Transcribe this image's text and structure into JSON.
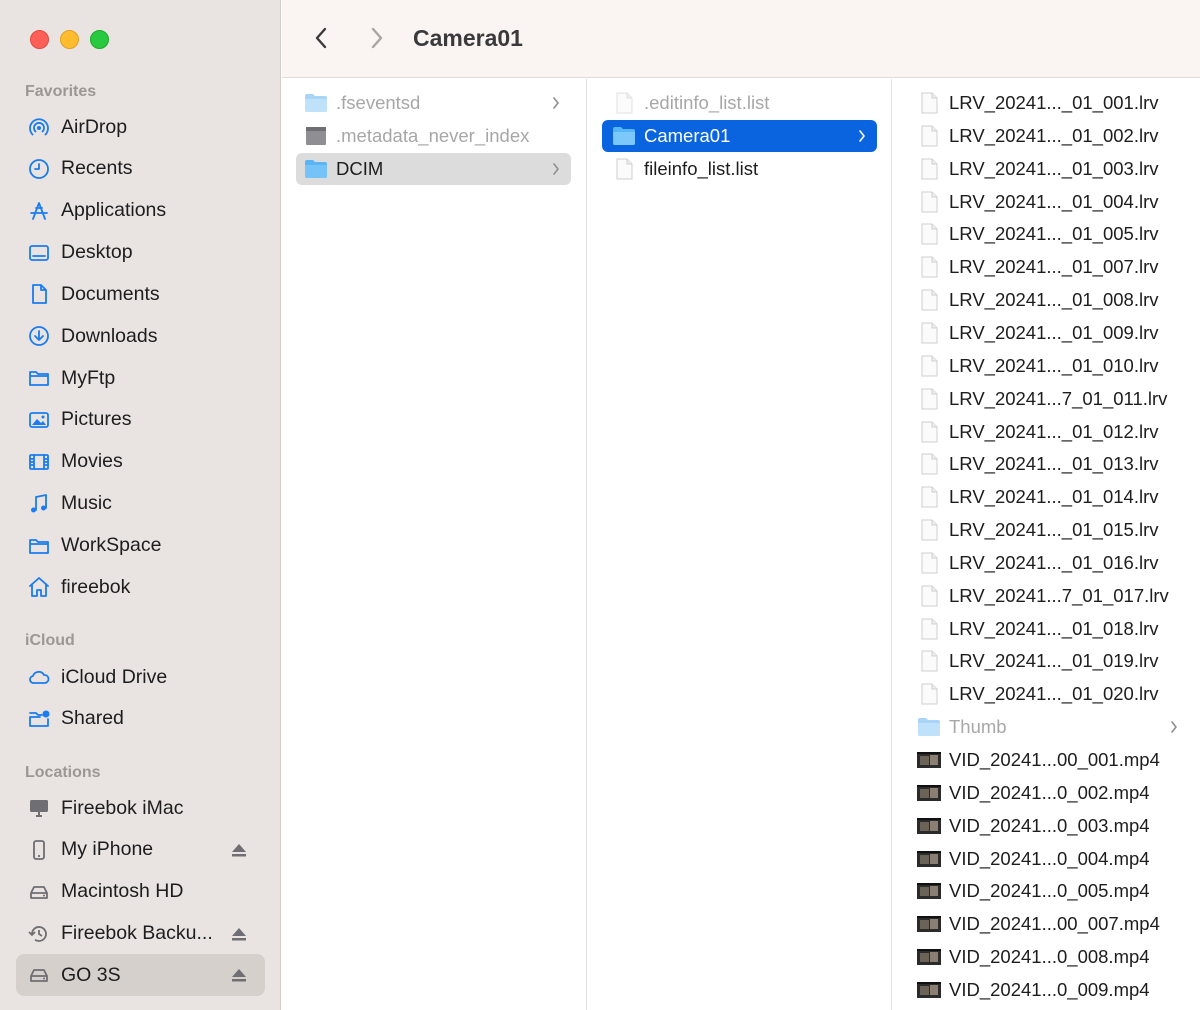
{
  "toolbar": {
    "title": "Camera01"
  },
  "sidebar": {
    "favorites_title": "Favorites",
    "favorites": [
      {
        "label": "AirDrop",
        "icon": "airdrop-icon"
      },
      {
        "label": "Recents",
        "icon": "clock-icon"
      },
      {
        "label": "Applications",
        "icon": "applications-icon"
      },
      {
        "label": "Desktop",
        "icon": "desktop-icon"
      },
      {
        "label": "Documents",
        "icon": "document-icon"
      },
      {
        "label": "Downloads",
        "icon": "download-icon"
      },
      {
        "label": "MyFtp",
        "icon": "folder-icon"
      },
      {
        "label": "Pictures",
        "icon": "pictures-icon"
      },
      {
        "label": "Movies",
        "icon": "film-icon"
      },
      {
        "label": "Music",
        "icon": "music-note-icon"
      },
      {
        "label": "WorkSpace",
        "icon": "folder-icon"
      },
      {
        "label": "fireebok",
        "icon": "home-icon"
      }
    ],
    "icloud_title": "iCloud",
    "icloud": [
      {
        "label": "iCloud Drive",
        "icon": "cloud-icon"
      },
      {
        "label": "Shared",
        "icon": "shared-folder-icon"
      }
    ],
    "locations_title": "Locations",
    "locations": [
      {
        "label": "Fireebok iMac",
        "icon": "imac-icon"
      },
      {
        "label": "My iPhone",
        "icon": "iphone-icon"
      },
      {
        "label": "Macintosh HD",
        "icon": "disk-icon"
      },
      {
        "label": "Fireebok Backu...",
        "icon": "time-machine-icon"
      },
      {
        "label": "GO 3S",
        "icon": "disk-icon"
      }
    ]
  },
  "column1": [
    {
      "name": ".fseventsd",
      "icon": "folder-icon",
      "dim": true
    },
    {
      "name": ".metadata_never_index",
      "icon": "gray-file-icon",
      "dim": true
    },
    {
      "name": "DCIM",
      "icon": "folder-icon",
      "selected": "gray"
    }
  ],
  "column2": [
    {
      "name": ".editinfo_list.list",
      "icon": "file-icon",
      "dim": true
    },
    {
      "name": "Camera01",
      "icon": "folder-icon",
      "selected": "blue"
    },
    {
      "name": "fileinfo_list.list",
      "icon": "file-icon"
    }
  ],
  "column3": [
    {
      "name": "LRV_20241..._01_001.lrv",
      "icon": "file-icon"
    },
    {
      "name": "LRV_20241..._01_002.lrv",
      "icon": "file-icon"
    },
    {
      "name": "LRV_20241..._01_003.lrv",
      "icon": "file-icon"
    },
    {
      "name": "LRV_20241..._01_004.lrv",
      "icon": "file-icon"
    },
    {
      "name": "LRV_20241..._01_005.lrv",
      "icon": "file-icon"
    },
    {
      "name": "LRV_20241..._01_007.lrv",
      "icon": "file-icon"
    },
    {
      "name": "LRV_20241..._01_008.lrv",
      "icon": "file-icon"
    },
    {
      "name": "LRV_20241..._01_009.lrv",
      "icon": "file-icon"
    },
    {
      "name": "LRV_20241..._01_010.lrv",
      "icon": "file-icon"
    },
    {
      "name": "LRV_20241...7_01_011.lrv",
      "icon": "file-icon"
    },
    {
      "name": "LRV_20241..._01_012.lrv",
      "icon": "file-icon"
    },
    {
      "name": "LRV_20241..._01_013.lrv",
      "icon": "file-icon"
    },
    {
      "name": "LRV_20241..._01_014.lrv",
      "icon": "file-icon"
    },
    {
      "name": "LRV_20241..._01_015.lrv",
      "icon": "file-icon"
    },
    {
      "name": "LRV_20241..._01_016.lrv",
      "icon": "file-icon"
    },
    {
      "name": "LRV_20241...7_01_017.lrv",
      "icon": "file-icon"
    },
    {
      "name": "LRV_20241..._01_018.lrv",
      "icon": "file-icon"
    },
    {
      "name": "LRV_20241..._01_019.lrv",
      "icon": "file-icon"
    },
    {
      "name": "LRV_20241..._01_020.lrv",
      "icon": "file-icon"
    },
    {
      "name": "Thumb",
      "icon": "folder-icon",
      "dim": true,
      "chevron": true
    },
    {
      "name": "VID_20241...00_001.mp4",
      "icon": "video-thumb-icon"
    },
    {
      "name": "VID_20241...0_002.mp4",
      "icon": "video-thumb-icon"
    },
    {
      "name": "VID_20241...0_003.mp4",
      "icon": "video-thumb-icon"
    },
    {
      "name": "VID_20241...0_004.mp4",
      "icon": "video-thumb-icon"
    },
    {
      "name": "VID_20241...0_005.mp4",
      "icon": "video-thumb-icon"
    },
    {
      "name": "VID_20241...00_007.mp4",
      "icon": "video-thumb-icon"
    },
    {
      "name": "VID_20241...0_008.mp4",
      "icon": "video-thumb-icon"
    },
    {
      "name": "VID_20241...0_009.mp4",
      "icon": "video-thumb-icon"
    }
  ],
  "colors": {
    "accent": "#0a64e0",
    "sidebar_icon": "#1a7cf0",
    "sidebar_bg": "#e9e4e1"
  }
}
